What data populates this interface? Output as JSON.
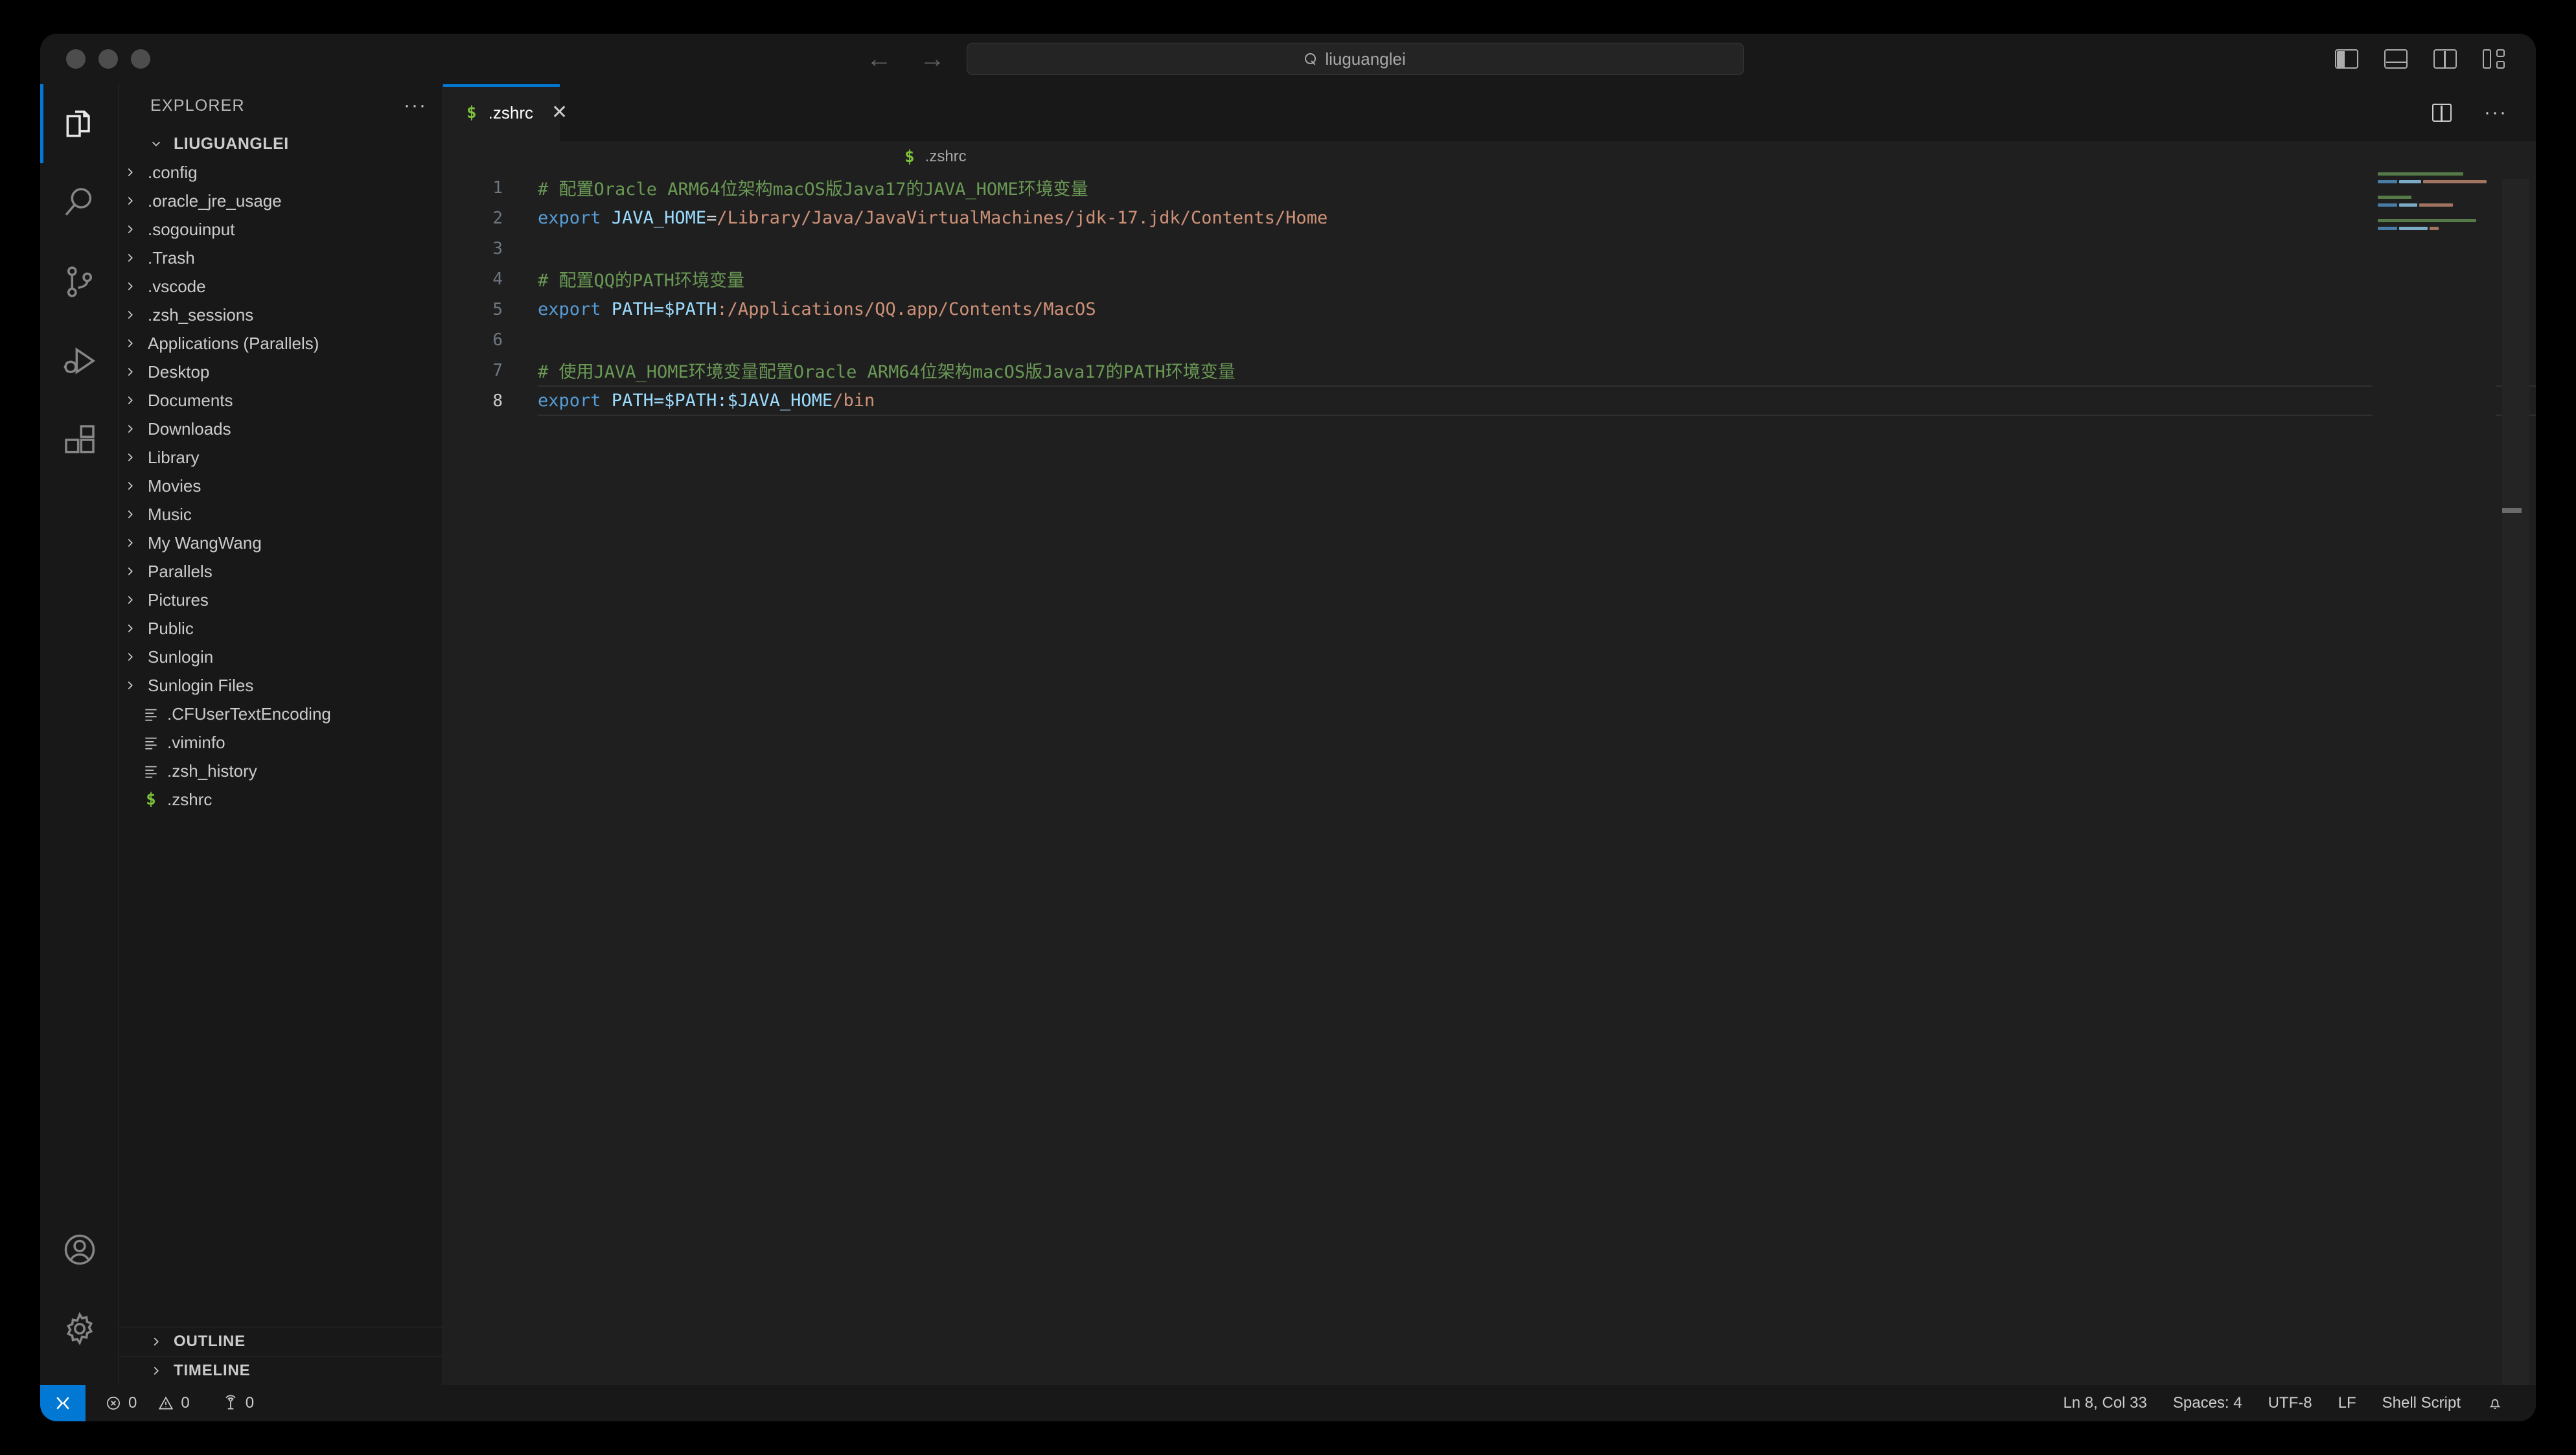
{
  "window": {
    "traffic_lights": [
      "close",
      "minimize",
      "maximize"
    ]
  },
  "titlebar": {
    "back_arrow": "←",
    "forward_arrow": "→",
    "command_center_text": "liuguanglei",
    "command_center_icon": "search-icon",
    "layout_icons": [
      "toggle-primary-sidebar-icon",
      "toggle-panel-icon",
      "toggle-secondary-sidebar-icon",
      "customize-layout-icon"
    ]
  },
  "activitybar": {
    "items": [
      {
        "name": "explorer",
        "icon": "files-icon",
        "active": true
      },
      {
        "name": "search",
        "icon": "search-icon",
        "active": false
      },
      {
        "name": "source-control",
        "icon": "source-control-icon",
        "active": false
      },
      {
        "name": "run-and-debug",
        "icon": "debug-icon",
        "active": false
      },
      {
        "name": "extensions",
        "icon": "extensions-icon",
        "active": false
      }
    ],
    "bottom": [
      {
        "name": "accounts",
        "icon": "account-icon"
      },
      {
        "name": "manage",
        "icon": "gear-icon"
      }
    ]
  },
  "sidebar": {
    "title": "EXPLORER",
    "more_actions": "···",
    "root": {
      "label": "LIUGUANGLEI",
      "expanded": true
    },
    "tree": [
      {
        "label": ".config",
        "type": "folder"
      },
      {
        "label": ".oracle_jre_usage",
        "type": "folder"
      },
      {
        "label": ".sogouinput",
        "type": "folder"
      },
      {
        "label": ".Trash",
        "type": "folder"
      },
      {
        "label": ".vscode",
        "type": "folder"
      },
      {
        "label": ".zsh_sessions",
        "type": "folder"
      },
      {
        "label": "Applications (Parallels)",
        "type": "folder"
      },
      {
        "label": "Desktop",
        "type": "folder"
      },
      {
        "label": "Documents",
        "type": "folder"
      },
      {
        "label": "Downloads",
        "type": "folder"
      },
      {
        "label": "Library",
        "type": "folder"
      },
      {
        "label": "Movies",
        "type": "folder"
      },
      {
        "label": "Music",
        "type": "folder"
      },
      {
        "label": "My WangWang",
        "type": "folder"
      },
      {
        "label": "Parallels",
        "type": "folder"
      },
      {
        "label": "Pictures",
        "type": "folder"
      },
      {
        "label": "Public",
        "type": "folder"
      },
      {
        "label": "Sunlogin",
        "type": "folder"
      },
      {
        "label": "Sunlogin Files",
        "type": "folder"
      },
      {
        "label": ".CFUserTextEncoding",
        "type": "file"
      },
      {
        "label": ".viminfo",
        "type": "file"
      },
      {
        "label": ".zsh_history",
        "type": "file"
      },
      {
        "label": ".zshrc",
        "type": "shell"
      }
    ],
    "sections": [
      {
        "label": "OUTLINE",
        "expanded": false
      },
      {
        "label": "TIMELINE",
        "expanded": false
      }
    ]
  },
  "editor": {
    "tab": {
      "label": ".zshrc",
      "icon": "shell-script-icon",
      "close": "✕",
      "active": true
    },
    "tab_actions": [
      "split-editor-icon",
      "more-actions-icon"
    ],
    "breadcrumb": {
      "label": ".zshrc",
      "icon": "shell-script-icon"
    },
    "lines": [
      {
        "n": 1,
        "tokens": [
          {
            "t": "comment",
            "v": "# 配置Oracle ARM64位架构macOS版Java17的JAVA_HOME环境变量"
          }
        ]
      },
      {
        "n": 2,
        "tokens": [
          {
            "t": "kw",
            "v": "export"
          },
          {
            "t": "op",
            "v": " "
          },
          {
            "t": "var",
            "v": "JAVA_HOME"
          },
          {
            "t": "op",
            "v": "="
          },
          {
            "t": "str",
            "v": "/Library/Java/JavaVirtualMachines/jdk-17.jdk/Contents/Home"
          }
        ]
      },
      {
        "n": 3,
        "tokens": []
      },
      {
        "n": 4,
        "tokens": [
          {
            "t": "comment",
            "v": "# 配置QQ的PATH环境变量"
          }
        ]
      },
      {
        "n": 5,
        "tokens": [
          {
            "t": "kw",
            "v": "export"
          },
          {
            "t": "op",
            "v": " "
          },
          {
            "t": "var",
            "v": "PATH=$PATH"
          },
          {
            "t": "str",
            "v": ":/Applications/QQ.app/Contents/MacOS"
          }
        ]
      },
      {
        "n": 6,
        "tokens": []
      },
      {
        "n": 7,
        "tokens": [
          {
            "t": "comment",
            "v": "# 使用JAVA_HOME环境变量配置Oracle ARM64位架构macOS版Java17的PATH环境变量"
          }
        ]
      },
      {
        "n": 8,
        "current": true,
        "tokens": [
          {
            "t": "kw",
            "v": "export"
          },
          {
            "t": "op",
            "v": " "
          },
          {
            "t": "var",
            "v": "PATH=$PATH:$JAVA_HOME"
          },
          {
            "t": "str",
            "v": "/bin"
          }
        ]
      }
    ],
    "minimap": [
      [
        {
          "c": "#6a9955",
          "w": 132
        }
      ],
      [
        {
          "c": "#569cd6",
          "w": 30
        },
        {
          "c": "#9cdcfe",
          "w": 34
        },
        {
          "c": "#ce9178",
          "w": 98
        }
      ],
      [],
      [
        {
          "c": "#6a9955",
          "w": 52
        }
      ],
      [
        {
          "c": "#569cd6",
          "w": 30
        },
        {
          "c": "#9cdcfe",
          "w": 28
        },
        {
          "c": "#ce9178",
          "w": 52
        }
      ],
      [],
      [
        {
          "c": "#6a9955",
          "w": 152
        }
      ],
      [
        {
          "c": "#569cd6",
          "w": 30
        },
        {
          "c": "#9cdcfe",
          "w": 44
        },
        {
          "c": "#ce9178",
          "w": 14
        }
      ]
    ]
  },
  "statusbar": {
    "remote_icon": "remote-window-icon",
    "left": [
      {
        "icon": "error-icon",
        "value": "0"
      },
      {
        "icon": "warning-icon",
        "value": "0"
      },
      {
        "icon": "ports-icon",
        "value": "0"
      }
    ],
    "right": [
      {
        "name": "cursor-position",
        "label": "Ln 8, Col 33"
      },
      {
        "name": "indentation",
        "label": "Spaces: 4"
      },
      {
        "name": "encoding",
        "label": "UTF-8"
      },
      {
        "name": "eol",
        "label": "LF"
      },
      {
        "name": "language-mode",
        "label": "Shell Script"
      }
    ],
    "notification_icon": "bell-icon"
  },
  "colors": {
    "accent": "#0078d4",
    "editor_bg": "#1f1f1f",
    "chrome_bg": "#181818",
    "comment": "#6a9955",
    "keyword": "#569cd6",
    "variable": "#9cdcfe",
    "string": "#ce9178",
    "shell_icon": "#7cc23b"
  }
}
